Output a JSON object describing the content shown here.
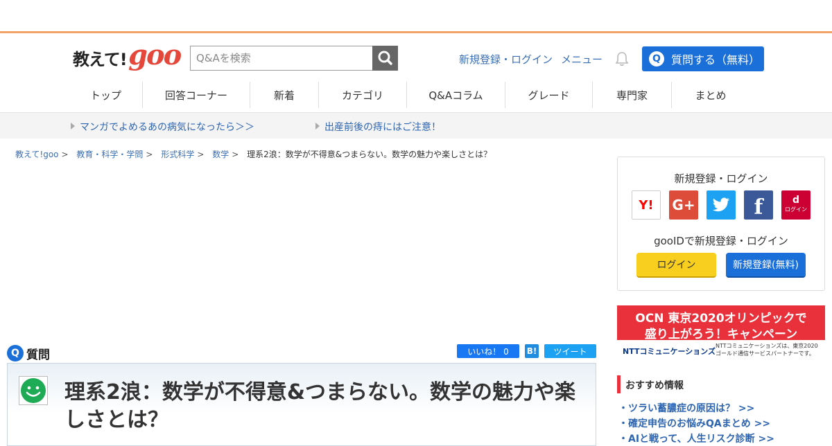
{
  "header": {
    "logo_text": "教えて!",
    "logo_goo": "goo",
    "search_placeholder": "Q&Aを検索",
    "signup_login": "新規登録・ログイン",
    "menu": "メニュー",
    "ask_button": "質問する（無料）",
    "ask_icon": "Q"
  },
  "nav": [
    "トップ",
    "回答コーナー",
    "新着",
    "カテゴリ",
    "Q&Aコラム",
    "グレード",
    "専門家",
    "まとめ"
  ],
  "promo": [
    "マンガでよめるあの病気になったら＞＞",
    "出産前後の痔にはご注意！"
  ],
  "breadcrumb": {
    "items": [
      "教えて!goo",
      "教育・科学・学問",
      "形式科学",
      "数学"
    ],
    "current": "理系2浪：数学が不得意&つまらない。数学の魅力や楽しさとは？",
    "sep": ">"
  },
  "question": {
    "section_label": "質問",
    "icon": "Q",
    "title": "理系2浪：数学が不得意&つまらない。数学の魅力や楽しさとは？",
    "like_label": "いいね！ 0",
    "hatena_label": "B!",
    "tweet_label": "ツイート"
  },
  "sidebar": {
    "login_heading": "新規登録・ログイン",
    "sns": [
      "Y!",
      "G+",
      "twitter",
      "f",
      "d ログイン"
    ],
    "sns_dlogin": "ログイン",
    "gooid_text": "gooIDで新規登録・ログイン",
    "login_button": "ログイン",
    "signup_button": "新規登録(無料)",
    "banner_line1": "OCN 東京2020オリンピックで",
    "banner_line2": "盛り上がろう！キャンペーン",
    "banner_ntt": "NTTコミュニケーションズ",
    "banner_small": "NTTコミュニケーションズは、東京2020 ゴールド通信サービスパートナーです。",
    "recommend_heading": "おすすめ情報",
    "recommend_items": [
      "・ツラい蓄膿症の原因は？ >>",
      "・確定申告のお悩みQAまとめ >>",
      "・AIと戦って、人生リスク診断 >>"
    ]
  },
  "colors": {
    "accent_orange": "#f3a266",
    "blue": "#1a6fd8",
    "link": "#3a6fb5",
    "red": "#e8313b"
  }
}
